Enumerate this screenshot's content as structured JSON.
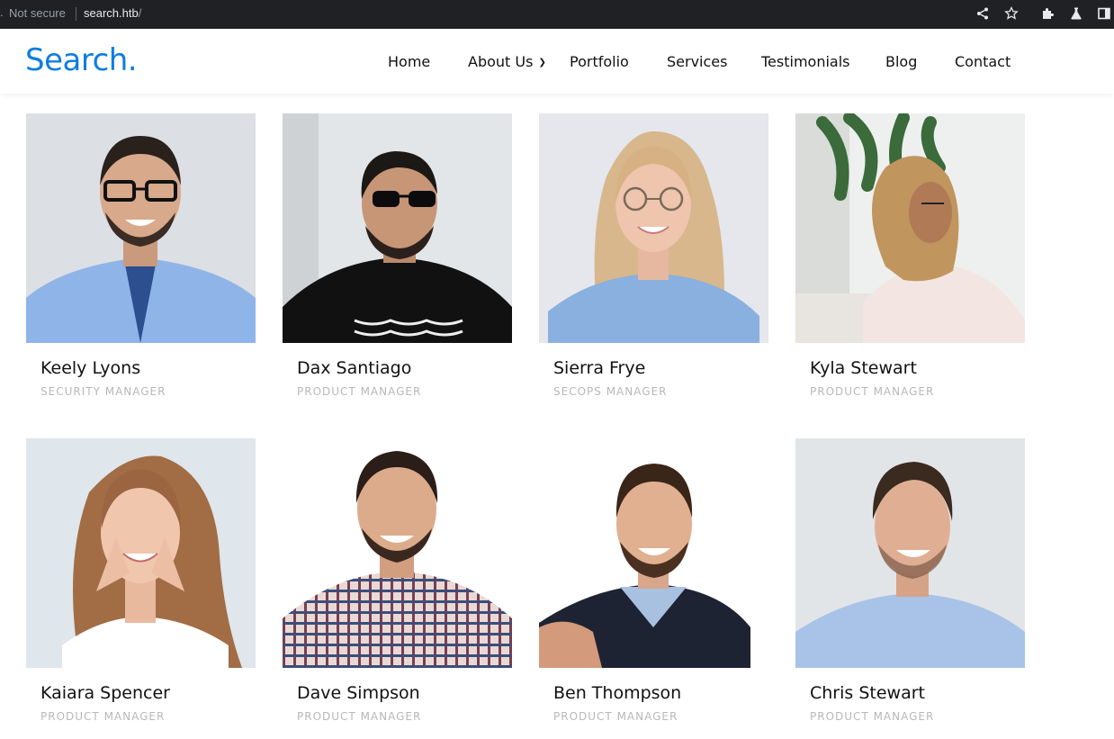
{
  "browser": {
    "left_fragment": ".",
    "security_label": "Not secure",
    "url_host": "search.htb",
    "url_path": "/",
    "icons": [
      "share-icon",
      "star-icon",
      "extensions-icon",
      "lab-icon",
      "sidepanel-icon"
    ]
  },
  "site": {
    "logo": "Search.",
    "accent_color": "#0d7de3"
  },
  "nav": {
    "items": [
      {
        "label": "Home"
      },
      {
        "label": "About Us"
      },
      {
        "label": "Portfolio"
      },
      {
        "label": "Services"
      },
      {
        "label": "Testimonials"
      },
      {
        "label": "Blog"
      },
      {
        "label": "Contact"
      }
    ]
  },
  "team": [
    {
      "name": "Keely Lyons",
      "role": "SECURITY MANAGER"
    },
    {
      "name": "Dax Santiago",
      "role": "PRODUCT MANAGER"
    },
    {
      "name": "Sierra Frye",
      "role": "SECOPS MANAGER"
    },
    {
      "name": "Kyla Stewart",
      "role": "PRODUCT MANAGER"
    },
    {
      "name": "Kaiara Spencer",
      "role": "PRODUCT MANAGER"
    },
    {
      "name": "Dave Simpson",
      "role": "PRODUCT MANAGER"
    },
    {
      "name": "Ben Thompson",
      "role": "PRODUCT MANAGER"
    },
    {
      "name": "Chris Stewart",
      "role": "PRODUCT MANAGER"
    }
  ]
}
